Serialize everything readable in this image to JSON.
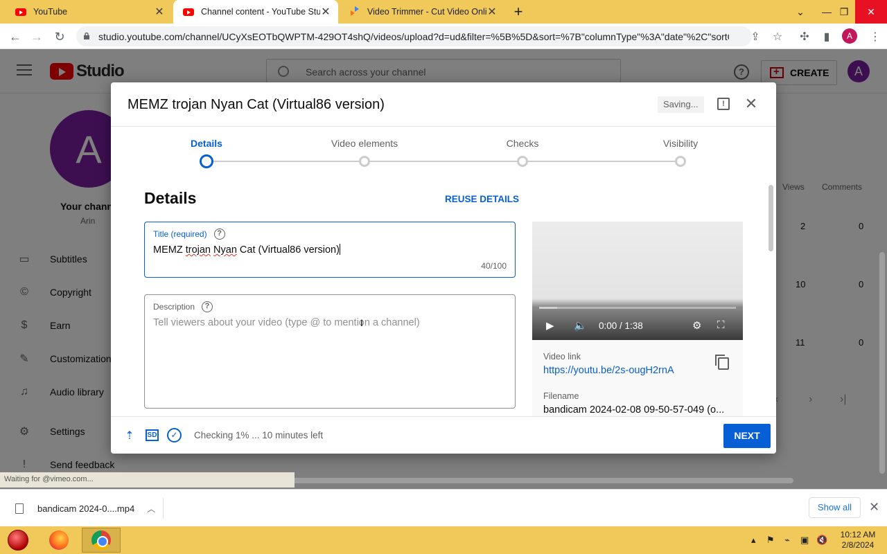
{
  "browser": {
    "tabs": [
      {
        "title": "YouTube",
        "active": false
      },
      {
        "title": "Channel content - YouTube Studio",
        "active": true
      },
      {
        "title": "Video Trimmer - Cut Video Online",
        "active": false
      }
    ],
    "url": "studio.youtube.com/channel/UCyXsEOTbQWPTM-429OT4shQ/videos/upload?d=ud&filter=%5B%5D&sort=%7B\"columnType\"%3A\"date\"%2C\"sortOr...",
    "profile_initial": "A",
    "status_text": "Waiting for @vimeo.com..."
  },
  "studio": {
    "logo_text": "Studio",
    "search_placeholder": "Search across your channel",
    "create_label": "CREATE",
    "avatar_initial": "A",
    "channel_label": "Your channel",
    "channel_name": "Arin",
    "sidebar": [
      {
        "label": "Subtitles",
        "icon": "subtitles-icon"
      },
      {
        "label": "Copyright",
        "icon": "copyright-icon"
      },
      {
        "label": "Earn",
        "icon": "earn-icon"
      },
      {
        "label": "Customization",
        "icon": "customization-icon"
      },
      {
        "label": "Audio library",
        "icon": "audio-library-icon"
      },
      {
        "label": "Settings",
        "icon": "settings-icon"
      },
      {
        "label": "Send feedback",
        "icon": "feedback-icon"
      }
    ],
    "table": {
      "headers": [
        "Views",
        "Comments"
      ],
      "rows": [
        {
          "views": "2",
          "comments": "0"
        },
        {
          "views": "10",
          "comments": "0"
        },
        {
          "views": "11",
          "comments": "0"
        }
      ]
    }
  },
  "dialog": {
    "title": "MEMZ trojan Nyan Cat (Virtual86 version)",
    "saving_label": "Saving...",
    "steps": [
      "Details",
      "Video elements",
      "Checks",
      "Visibility"
    ],
    "active_step": "Details",
    "section_title": "Details",
    "reuse_label": "REUSE DETAILS",
    "title_field": {
      "label": "Title (required)",
      "value_parts": [
        "MEMZ ",
        "trojan",
        " ",
        "Nyan",
        " Cat (Virtual86 version)"
      ],
      "counter": "40/100"
    },
    "description_field": {
      "label": "Description",
      "placeholder": "Tell viewers about your video (type @ to mention a channel)"
    },
    "video": {
      "time": "0:00 / 1:38",
      "progress": 0.09,
      "link_label": "Video link",
      "link": "https://youtu.be/2s-ougH2rnA",
      "filename_label": "Filename",
      "filename": "bandicam 2024-02-08 09-50-57-049 (o..."
    },
    "footer": {
      "sd_badge": "SD",
      "status": "Checking 1% ... 10 minutes left",
      "next_label": "NEXT"
    }
  },
  "downloads": {
    "item": "bandicam 2024-0....mp4",
    "show_all": "Show all"
  },
  "taskbar": {
    "time": "10:12 AM",
    "date": "2/8/2024"
  },
  "colors": {
    "accent": "#065fd4",
    "brand_red": "#ff0000",
    "tabstrip": "#f0c95a",
    "avatar": "#7b1fa2"
  }
}
